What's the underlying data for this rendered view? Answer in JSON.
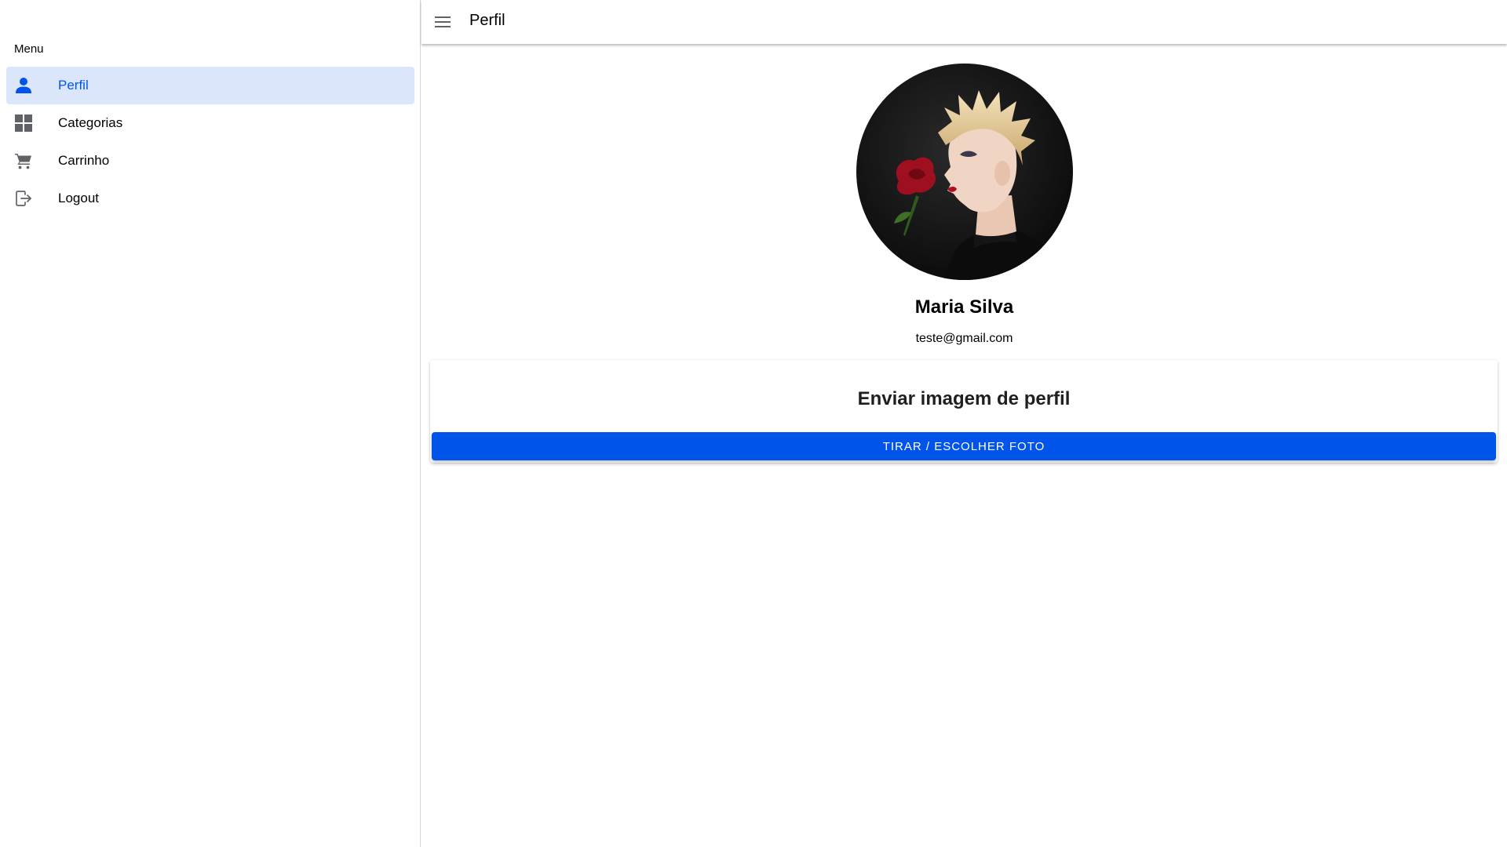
{
  "sidebar": {
    "header": "Menu",
    "items": [
      {
        "label": "Perfil",
        "icon": "person-icon",
        "active": true
      },
      {
        "label": "Categorias",
        "icon": "grid-icon",
        "active": false
      },
      {
        "label": "Carrinho",
        "icon": "cart-icon",
        "active": false
      },
      {
        "label": "Logout",
        "icon": "logout-icon",
        "active": false
      }
    ]
  },
  "toolbar": {
    "title": "Perfil",
    "menu_icon": "hamburger-menu-icon"
  },
  "profile": {
    "name": "Maria Silva",
    "email": "teste@gmail.com"
  },
  "upload": {
    "title": "Enviar imagem de perfil",
    "button_label": "TIRAR / ESCOLHER FOTO"
  },
  "colors": {
    "accent": "#0054e9",
    "active_item_bg": "#dce6fb",
    "icon_gray": "#5f6368"
  }
}
